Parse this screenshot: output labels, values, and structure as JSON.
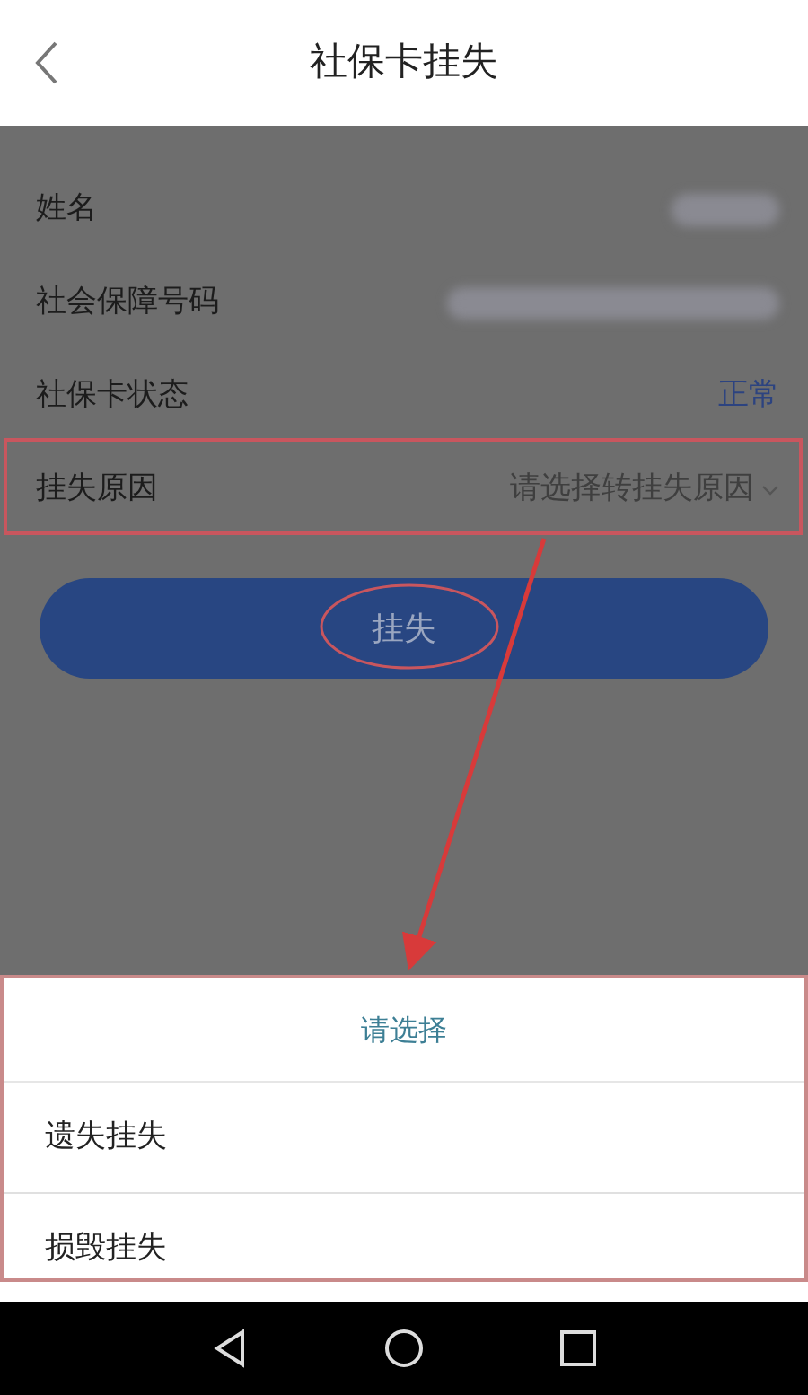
{
  "header": {
    "title": "社保卡挂失"
  },
  "fields": [
    {
      "kind": "redacted",
      "label": "姓名"
    },
    {
      "kind": "redacted",
      "label": "社会保障号码"
    },
    {
      "kind": "status",
      "label": "社保卡状态",
      "value": "正常"
    },
    {
      "kind": "select",
      "label": "挂失原因",
      "placeholder": "请选择转挂失原因"
    }
  ],
  "submit_button": {
    "label": "挂失"
  },
  "picker": {
    "title": "请选择",
    "options": [
      {
        "label": "遗失挂失"
      },
      {
        "label": "损毁挂失"
      }
    ]
  },
  "annotations": [
    {
      "kind": "rectangle"
    },
    {
      "kind": "ellipse"
    },
    {
      "kind": "arrow"
    }
  ]
}
